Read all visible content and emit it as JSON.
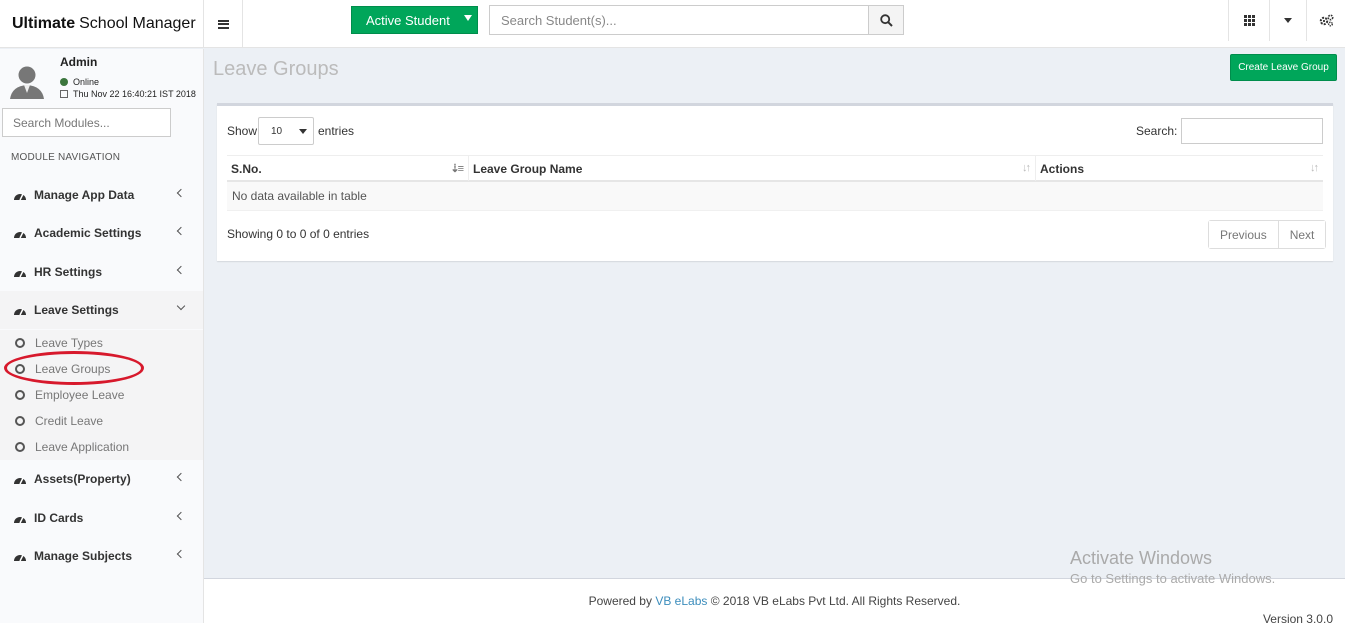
{
  "app": {
    "title_bold": "Ultimate",
    "title_rest": "School Manager"
  },
  "topbar": {
    "active_student_label": "Active Student",
    "student_search_placeholder": "Search Student(s)..."
  },
  "user": {
    "name": "Admin",
    "status": "Online",
    "datetime": "Thu Nov 22 16:40:21 IST 2018",
    "status_color": "#3c763d"
  },
  "sidebar": {
    "module_search_placeholder": "Search Modules...",
    "nav_header": "MODULE NAVIGATION",
    "items": [
      {
        "label": "Manage App Data"
      },
      {
        "label": "Academic Settings"
      },
      {
        "label": "HR Settings"
      },
      {
        "label": "Leave Settings"
      },
      {
        "label": "Assets(Property)"
      },
      {
        "label": "ID Cards"
      },
      {
        "label": "Manage Subjects"
      }
    ],
    "leave_subitems": [
      {
        "label": "Leave Types"
      },
      {
        "label": "Leave Groups"
      },
      {
        "label": "Employee Leave"
      },
      {
        "label": "Credit Leave"
      },
      {
        "label": "Leave Application"
      }
    ]
  },
  "content": {
    "page_title": "Leave Groups",
    "create_button": "Create Leave Group",
    "show_label": "Show",
    "page_length": "10",
    "entries_label": "entries",
    "search_label": "Search:",
    "columns": [
      "S.No.",
      "Leave Group Name",
      "Actions"
    ],
    "empty_message": "No data available in table",
    "info": "Showing 0 to 0 of 0 entries",
    "prev_label": "Previous",
    "next_label": "Next"
  },
  "footer": {
    "powered_by": "Powered by",
    "company_link": "VB eLabs",
    "copyright": "© 2018 VB eLabs Pvt Ltd. All Rights Reserved.",
    "version": "Version 3.0.0"
  },
  "watermark": {
    "line1": "Activate Windows",
    "line2": "Go to Settings to activate Windows."
  },
  "colors": {
    "accent_green": "#00a65a",
    "link_blue": "#3c8dbc",
    "highlight_red": "#d7192c"
  }
}
